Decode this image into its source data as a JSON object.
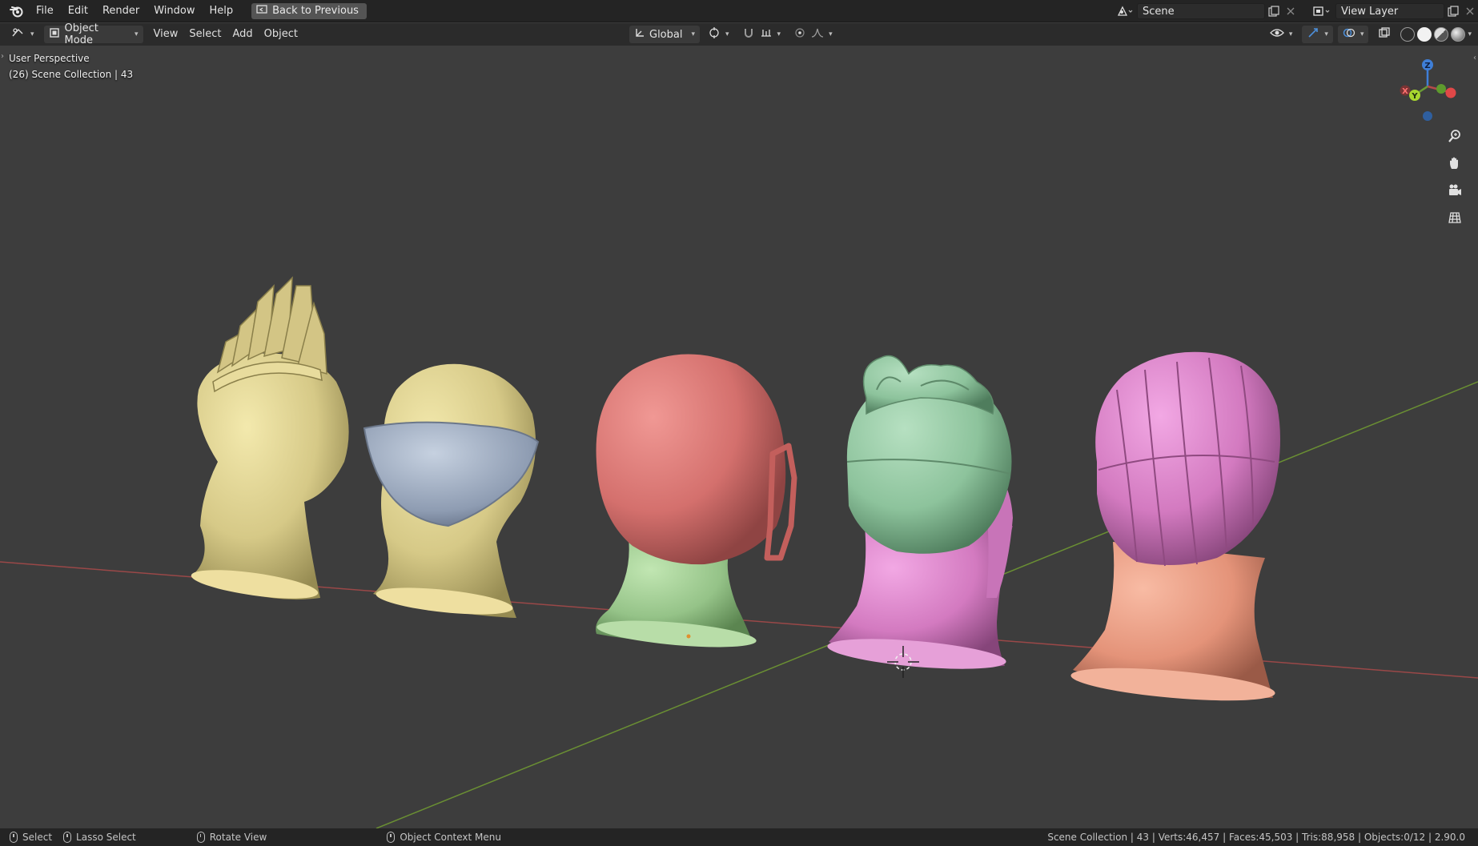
{
  "menu": {
    "items": [
      "File",
      "Edit",
      "Render",
      "Window",
      "Help"
    ],
    "back_button": "Back to Previous"
  },
  "topright": {
    "scene_name": "Scene",
    "view_layer_name": "View Layer"
  },
  "header": {
    "mode": "Object Mode",
    "menus": [
      "View",
      "Select",
      "Add",
      "Object"
    ],
    "transform_orientation": "Global"
  },
  "viewport": {
    "perspective_label": "User Perspective",
    "collection_label": "(26) Scene Collection | 43",
    "gizmo": {
      "x_label": "X",
      "y_label": "Y",
      "z_label": "Z"
    }
  },
  "statusbar": {
    "select": "Select",
    "lasso": "Lasso Select",
    "rotate": "Rotate View",
    "context_menu": "Object Context Menu",
    "stats": "Scene Collection | 43 | Verts:46,457 | Faces:45,503 | Tris:88,958 | Objects:0/12 | 2.90.0"
  },
  "colors": {
    "x_axis": "#b54a4a",
    "y_axis": "#6a9a35",
    "z_axis": "#3f7fd8",
    "head_yellow": "#d8cc8a",
    "head_red": "#d9726f",
    "head_green": "#9ccb8f",
    "head_pink": "#d67ec4",
    "head_salmon": "#e6947c",
    "hair_blue": "#9aa8bd"
  },
  "icons": {
    "logo": "blender-logo-icon",
    "zoom": "zoom-icon",
    "pan": "hand-icon",
    "camera": "camera-icon",
    "grid": "grid-icon"
  }
}
